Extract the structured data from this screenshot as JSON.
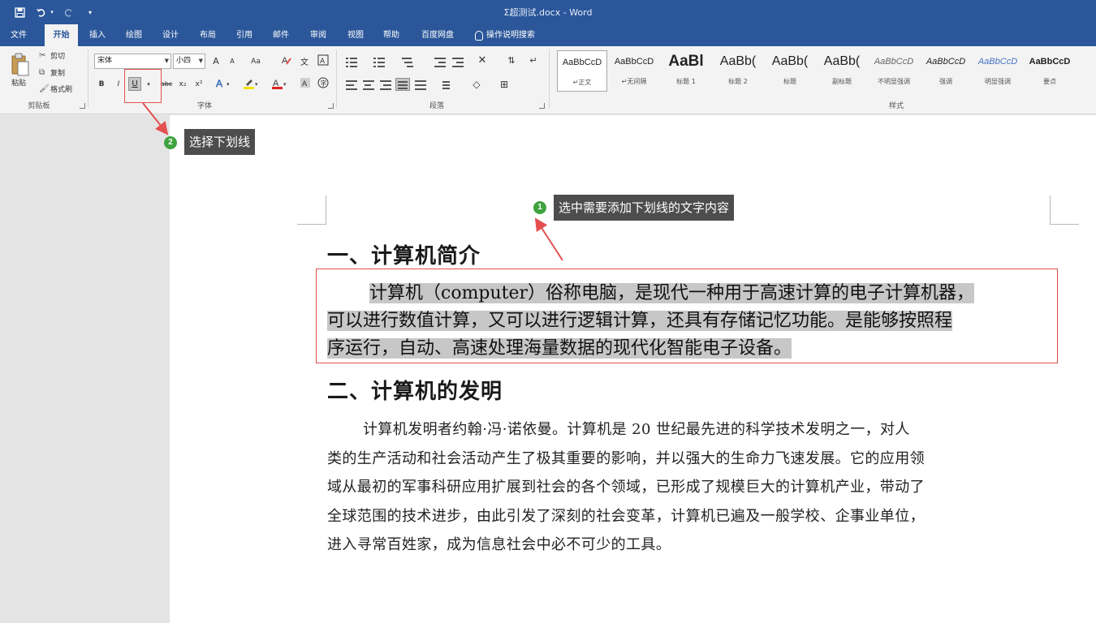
{
  "title_bar": {
    "document_title": "Σ超测试.docx - Word",
    "quick_access": [
      "save-icon",
      "undo-icon",
      "redo-icon",
      "customize-icon"
    ]
  },
  "tabs": {
    "file": "文件",
    "home": "开始",
    "insert": "插入",
    "draw": "绘图",
    "design": "设计",
    "layout": "布局",
    "references": "引用",
    "mailings": "邮件",
    "review": "审阅",
    "view": "视图",
    "help": "帮助",
    "baidu": "百度网盘",
    "tell_me": "操作说明搜索"
  },
  "clipboard": {
    "paste": "粘贴",
    "cut": "剪切",
    "copy": "复制",
    "format_painter": "格式刷",
    "group_label": "剪贴板"
  },
  "font": {
    "font_name": "宋体",
    "font_size": "小四",
    "grow": "A",
    "shrink": "A",
    "case": "Aa",
    "bold": "B",
    "italic": "I",
    "underline": "U",
    "strike": "abc",
    "subscript": "x₂",
    "superscript": "x²",
    "group_label": "字体"
  },
  "paragraph": {
    "group_label": "段落"
  },
  "styles": {
    "group_label": "样式",
    "items": [
      {
        "sample": "AaBbCcD",
        "name": "↵正文"
      },
      {
        "sample": "AaBbCcD",
        "name": "↵无间隔"
      },
      {
        "sample": "AaBl",
        "name": "标题 1"
      },
      {
        "sample": "AaBb(",
        "name": "标题 2"
      },
      {
        "sample": "AaBb(",
        "name": "标题"
      },
      {
        "sample": "AaBb(",
        "name": "副标题"
      },
      {
        "sample": "AaBbCcD",
        "name": "不明显强调"
      },
      {
        "sample": "AaBbCcD",
        "name": "强调"
      },
      {
        "sample": "AaBbCcD",
        "name": "明显强调"
      },
      {
        "sample": "AaBbCcD",
        "name": "要点"
      }
    ]
  },
  "annotations": {
    "step1_number": "1",
    "step1_text": "选中需要添加下划线的文字内容",
    "step2_number": "2",
    "step2_text": "选择下划线"
  },
  "document": {
    "heading1": "一、计算机简介",
    "para1_line1": "计算机（computer）俗称电脑，是现代一种用于高速计算的电子计算机器，",
    "para1_line2": "可以进行数值计算，又可以进行逻辑计算，还具有存储记忆功能。是能够按照程",
    "para1_line3": "序运行，自动、高速处理海量数据的现代化智能电子设备。",
    "heading2": "二、计算机的发明",
    "para2_line1": "计算机发明者约翰·冯·诺依曼。计算机是 20 世纪最先进的科学技术发明之一，对人",
    "para2_line2": "类的生产活动和社会活动产生了极其重要的影响，并以强大的生命力飞速发展。它的应用领",
    "para2_line3": "域从最初的军事科研应用扩展到社会的各个领域，已形成了规模巨大的计算机产业，带动了",
    "para2_line4": "全球范围的技术进步，由此引发了深刻的社会变革，计算机已遍及一般学校、企事业单位，",
    "para2_line5": "进入寻常百姓家，成为信息社会中必不可少的工具。"
  },
  "colors": {
    "word_blue": "#2b579a",
    "callout_red": "#e3504f",
    "badge_green": "#3fa33f",
    "selection_gray": "#c7c7c7"
  }
}
